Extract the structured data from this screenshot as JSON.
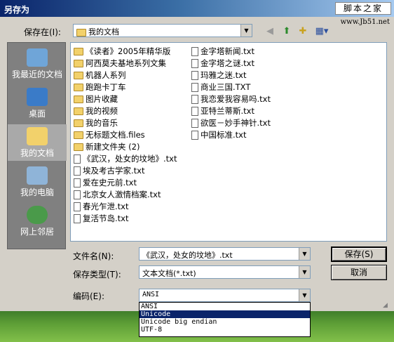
{
  "window": {
    "title": "另存为"
  },
  "watermark": {
    "text": "脚本之家",
    "url": "www.Jb51.net"
  },
  "save_in": {
    "label": "保存在(I):",
    "value": "我的文档"
  },
  "toolbar": {
    "icons": [
      "back-icon",
      "up-folder-icon",
      "new-folder-icon",
      "view-menu-icon"
    ]
  },
  "places": [
    {
      "label": "我最近的文档",
      "icon": "recent-documents-icon"
    },
    {
      "label": "桌面",
      "icon": "desktop-icon"
    },
    {
      "label": "我的文档",
      "icon": "my-documents-icon"
    },
    {
      "label": "我的电脑",
      "icon": "my-computer-icon"
    },
    {
      "label": "网上邻居",
      "icon": "network-places-icon"
    }
  ],
  "files_col1": [
    {
      "name": "《读者》2005年精华版",
      "type": "folder"
    },
    {
      "name": "阿西莫夫基地系列文集",
      "type": "folder"
    },
    {
      "name": "机器人系列",
      "type": "folder"
    },
    {
      "name": "跑跑卡丁车",
      "type": "folder"
    },
    {
      "name": "图片收藏",
      "type": "folder"
    },
    {
      "name": "我的视频",
      "type": "folder"
    },
    {
      "name": "我的音乐",
      "type": "folder"
    },
    {
      "name": "无标题文档.files",
      "type": "folder"
    },
    {
      "name": "新建文件夹 (2)",
      "type": "folder"
    },
    {
      "name": "《武汉，处女的坟地》.txt",
      "type": "file"
    },
    {
      "name": "埃及考古学家.txt",
      "type": "file"
    },
    {
      "name": "爱在史元前.txt",
      "type": "file"
    },
    {
      "name": "北京女人激情档案.txt",
      "type": "file"
    },
    {
      "name": "春光乍泄.txt",
      "type": "file"
    },
    {
      "name": "复活节岛.txt",
      "type": "file"
    }
  ],
  "files_col2": [
    {
      "name": "金字塔新闻.txt",
      "type": "file"
    },
    {
      "name": "金字塔之谜.txt",
      "type": "file"
    },
    {
      "name": "玛雅之迷.txt",
      "type": "file"
    },
    {
      "name": "商业三国.TXT",
      "type": "file"
    },
    {
      "name": "我恋爱我容易吗.txt",
      "type": "file"
    },
    {
      "name": "亚特兰蒂斯.txt",
      "type": "file"
    },
    {
      "name": "欲医－妙手神针.txt",
      "type": "file"
    },
    {
      "name": "中国标准.txt",
      "type": "file"
    }
  ],
  "filename": {
    "label": "文件名(N):",
    "value": "《武汉，处女的坟地》.txt"
  },
  "filetype": {
    "label": "保存类型(T):",
    "value": "文本文档(*.txt)"
  },
  "encoding": {
    "label": "编码(E):",
    "value": "ANSI",
    "options": [
      "ANSI",
      "Unicode",
      "Unicode big endian",
      "UTF-8"
    ],
    "highlighted": "Unicode"
  },
  "buttons": {
    "save": "保存(S)",
    "cancel": "取消"
  }
}
